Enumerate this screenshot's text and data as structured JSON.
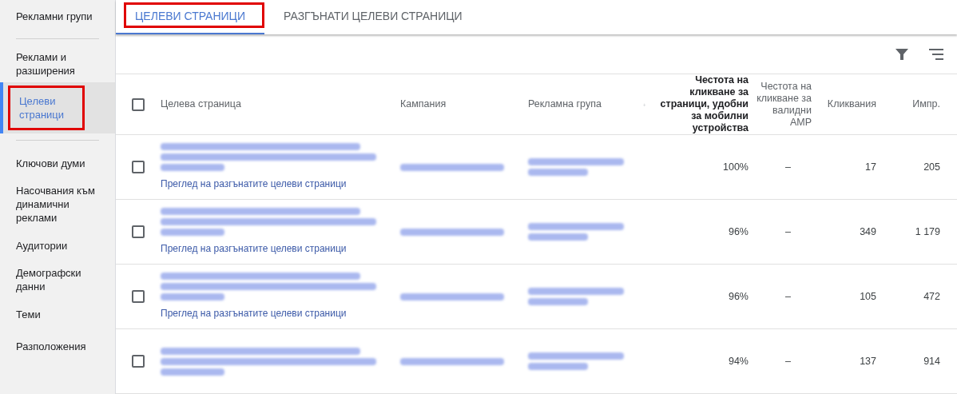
{
  "sidebar": {
    "items": [
      {
        "label": "Рекламни групи",
        "selected": false,
        "highlighted": false,
        "divider_after": true
      },
      {
        "label": "Реклами и разширения",
        "selected": false,
        "highlighted": false,
        "divider_after": false
      },
      {
        "label": "Целеви страници",
        "selected": true,
        "highlighted": true,
        "divider_after": true
      },
      {
        "label": "Ключови думи",
        "selected": false,
        "highlighted": false,
        "divider_after": false
      },
      {
        "label": "Насочвания към динамични реклами",
        "selected": false,
        "highlighted": false,
        "divider_after": false
      },
      {
        "label": "Аудитории",
        "selected": false,
        "highlighted": false,
        "divider_after": false
      },
      {
        "label": "Демографски данни",
        "selected": false,
        "highlighted": false,
        "divider_after": false
      },
      {
        "label": "Теми",
        "selected": false,
        "highlighted": false,
        "divider_after": false
      },
      {
        "label": "Разположения",
        "selected": false,
        "highlighted": false,
        "divider_after": false
      }
    ]
  },
  "tabs": [
    {
      "label": "ЦЕЛЕВИ СТРАНИЦИ",
      "selected": true,
      "highlighted": true
    },
    {
      "label": "РАЗГЪНАТИ ЦЕЛЕВИ СТРАНИЦИ",
      "selected": false,
      "highlighted": false
    }
  ],
  "table": {
    "select_all": {
      "checked": false
    },
    "columns": [
      {
        "label": "Целева страница",
        "sorted": false
      },
      {
        "label": "Кампания",
        "sorted": false
      },
      {
        "label": "Рекламна група",
        "sorted": false
      },
      {
        "label": "Честота на кликване за страници, удобни за мобилни устройства",
        "sorted": true
      },
      {
        "label": "Честота на кликване за валидни AMP",
        "sorted": false
      },
      {
        "label": "Кликвания",
        "sorted": false
      },
      {
        "label": "Импр.",
        "sorted": false
      }
    ],
    "rows": [
      {
        "checked": false,
        "link": "Преглед на разгънатите целеви страници",
        "mobile_ctr": "100%",
        "amp_ctr": "–",
        "clicks": "17",
        "impressions": "205"
      },
      {
        "checked": false,
        "link": "Преглед на разгънатите целеви страници",
        "mobile_ctr": "96%",
        "amp_ctr": "–",
        "clicks": "349",
        "impressions": "1 179"
      },
      {
        "checked": false,
        "link": "Преглед на разгънатите целеви страници",
        "mobile_ctr": "96%",
        "amp_ctr": "–",
        "clicks": "105",
        "impressions": "472"
      },
      {
        "checked": false,
        "mobile_ctr": "94%",
        "amp_ctr": "–",
        "clicks": "137",
        "impressions": "914"
      }
    ]
  }
}
